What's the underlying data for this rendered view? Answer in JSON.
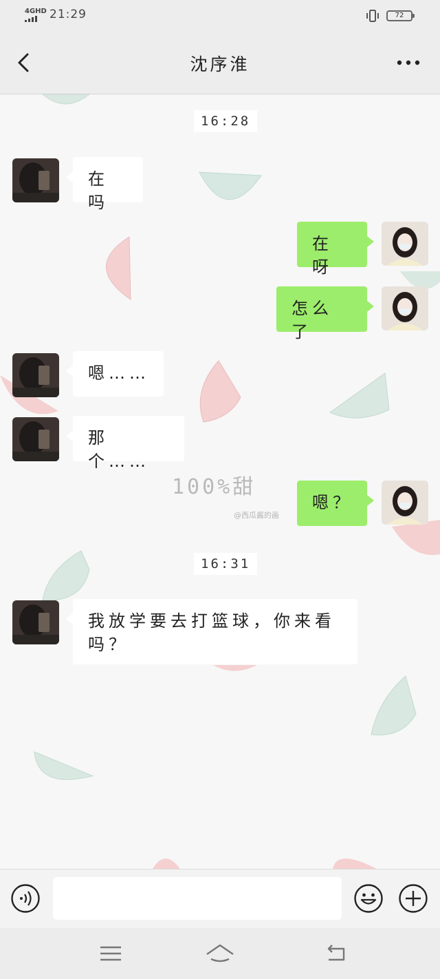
{
  "status_bar": {
    "network": "4GHD",
    "time": "21:29",
    "battery": "72"
  },
  "header": {
    "contact_name": "沈序淮"
  },
  "watermark": {
    "text": "100%甜",
    "signature": "@西瓜酱的画"
  },
  "timestamps": [
    "16:28",
    "16:31"
  ],
  "messages": [
    {
      "from": "them",
      "text": "在吗"
    },
    {
      "from": "me",
      "text": "在呀"
    },
    {
      "from": "me",
      "text": "怎么了"
    },
    {
      "from": "them",
      "text": "嗯……"
    },
    {
      "from": "them",
      "text": "那个……"
    },
    {
      "from": "me",
      "text": "嗯？"
    },
    {
      "from": "them",
      "text": "我放学要去打篮球，你来看吗？"
    }
  ],
  "input": {
    "value": ""
  },
  "icons": {
    "back": "chevron-left-icon",
    "more": "more-dots-icon",
    "voice": "voice-icon",
    "emoji": "emoji-icon",
    "plus": "plus-icon",
    "sys_menu": "menu-icon",
    "sys_home": "home-icon",
    "sys_back": "back-icon"
  },
  "colors": {
    "outgoing_bubble": "#9ced6b",
    "incoming_bubble": "#ffffff",
    "chrome": "#ededed"
  }
}
